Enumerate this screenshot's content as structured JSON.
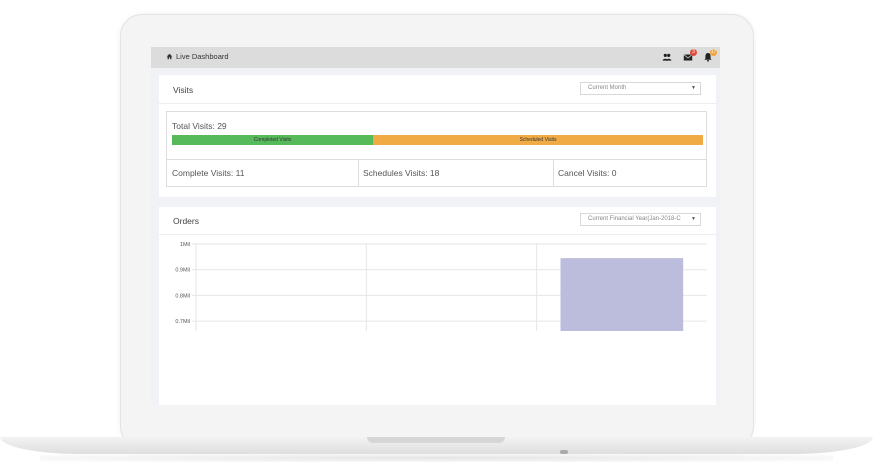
{
  "topbar": {
    "title": "Live Dashboard",
    "icons": [
      {
        "name": "users-icon",
        "badge": ""
      },
      {
        "name": "envelope-icon",
        "badge": "3"
      },
      {
        "name": "bell-icon",
        "badge": "17"
      }
    ]
  },
  "visits": {
    "title": "Visits",
    "filter_value": "Current Month",
    "total_label": "Total Visits: 29",
    "progress": [
      {
        "label": "Completed Visits",
        "fraction": 0.3793,
        "color": "#56b95a"
      },
      {
        "label": "Scheduled Visits",
        "fraction": 0.6207,
        "color": "#f0ab44"
      }
    ],
    "stats": {
      "complete": "Complete Visits: 11",
      "scheduled": "Schedules Visits: 18",
      "cancel": "Cancel Visits: 0"
    }
  },
  "orders": {
    "title": "Orders",
    "filter_value": "Current Financial Year(Jan-2018-C"
  },
  "chart_data": {
    "type": "bar",
    "title": "",
    "xlabel": "",
    "ylabel": "",
    "y_tick_labels": [
      "1Mil",
      "0.9Mil",
      "0.8Mil",
      "0.7Mil"
    ],
    "y_tick_values": [
      1000000,
      900000,
      800000,
      700000
    ],
    "categories": [
      "",
      "",
      ""
    ],
    "values": [
      null,
      null,
      945000
    ],
    "bar_color": "#bcbcdc",
    "grid": true,
    "ylim": [
      700000,
      1000000
    ]
  }
}
